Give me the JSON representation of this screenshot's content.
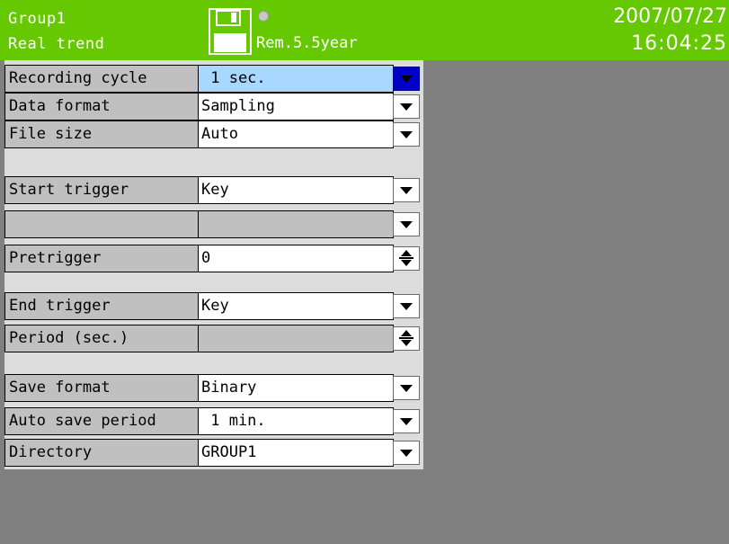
{
  "header": {
    "group": "Group1",
    "screen": "Real trend",
    "remaining": "Rem.5.5year",
    "date": "2007/07/27",
    "time": "16:04:25",
    "bar_color": "#66c800",
    "icons": [
      "floppy-disk-icon",
      "status-dot-icon"
    ]
  },
  "settings": {
    "recording_cycle": {
      "label": "Recording cycle",
      "value": " 1 sec.",
      "control": "dropdown",
      "selected": true
    },
    "data_format": {
      "label": "Data format",
      "value": "Sampling",
      "control": "dropdown"
    },
    "file_size": {
      "label": "File size",
      "value": "Auto",
      "control": "dropdown"
    },
    "start_trigger": {
      "label": "Start trigger",
      "value": "Key",
      "control": "dropdown"
    },
    "start_trigger_sub": {
      "label": "",
      "value": "",
      "control": "dropdown",
      "disabled": true
    },
    "pretrigger": {
      "label": "Pretrigger",
      "value": "0",
      "control": "spinner"
    },
    "end_trigger": {
      "label": "End trigger",
      "value": "Key",
      "control": "dropdown"
    },
    "period": {
      "label": "Period (sec.)",
      "value": "",
      "control": "spinner",
      "disabled": true
    },
    "save_format": {
      "label": "Save format",
      "value": "Binary",
      "control": "dropdown"
    },
    "auto_save_period": {
      "label": "Auto save period",
      "value": " 1 min.",
      "control": "dropdown"
    },
    "directory": {
      "label": "Directory",
      "value": "GROUP1",
      "control": "dropdown"
    }
  }
}
